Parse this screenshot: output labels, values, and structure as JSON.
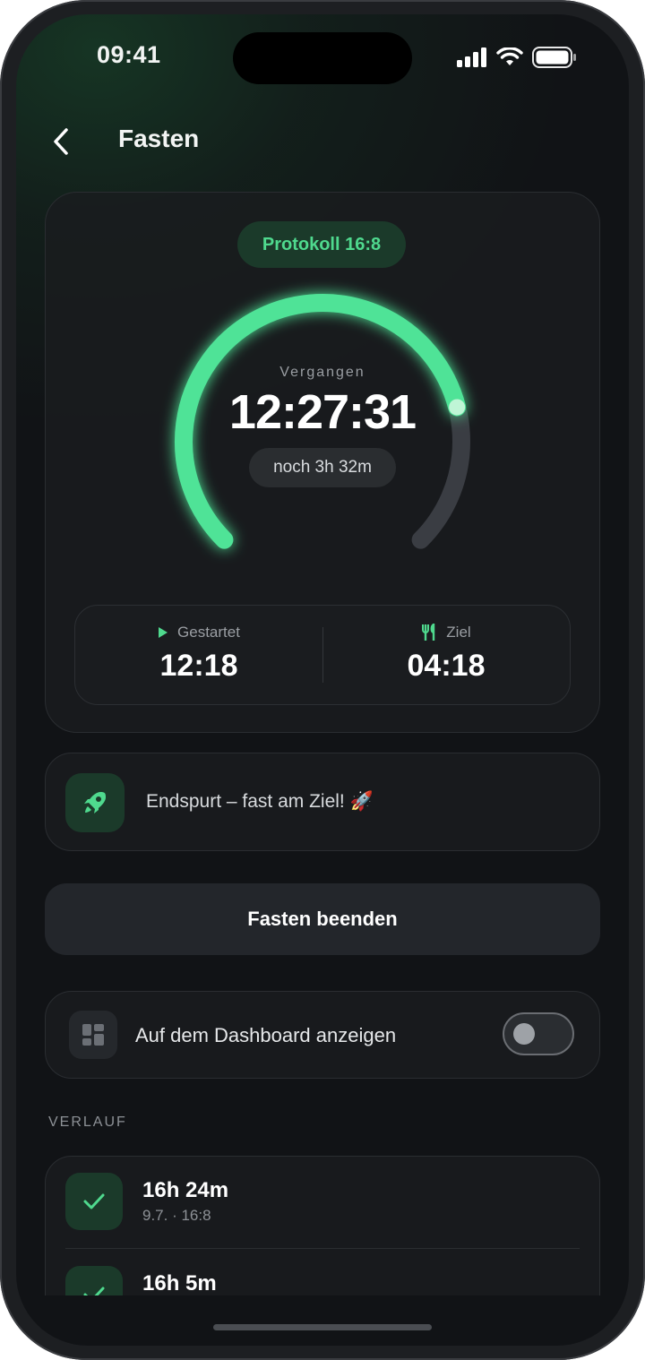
{
  "status_bar": {
    "time": "09:41"
  },
  "header": {
    "title": "Fasten"
  },
  "timer": {
    "protocol": "Protokoll 16:8",
    "elapsed_label": "Vergangen",
    "elapsed": "12:27:31",
    "remaining": "noch 3h 32m",
    "progress_fraction": 0.78,
    "accent_color": "#4fe397"
  },
  "times": {
    "started_label": "Gestartet",
    "started": "12:18",
    "goal_label": "Ziel",
    "goal": "04:18"
  },
  "tip": {
    "text": "Endspurt – fast am Ziel! 🚀"
  },
  "end_button": {
    "label": "Fasten beenden"
  },
  "dashboard": {
    "label": "Auf dem Dashboard anzeigen",
    "enabled": false
  },
  "history": {
    "title": "VERLAUF",
    "items": [
      {
        "duration": "16h 24m",
        "meta": "9.7. · 16:8"
      },
      {
        "duration": "16h 5m",
        "meta": ""
      }
    ]
  }
}
